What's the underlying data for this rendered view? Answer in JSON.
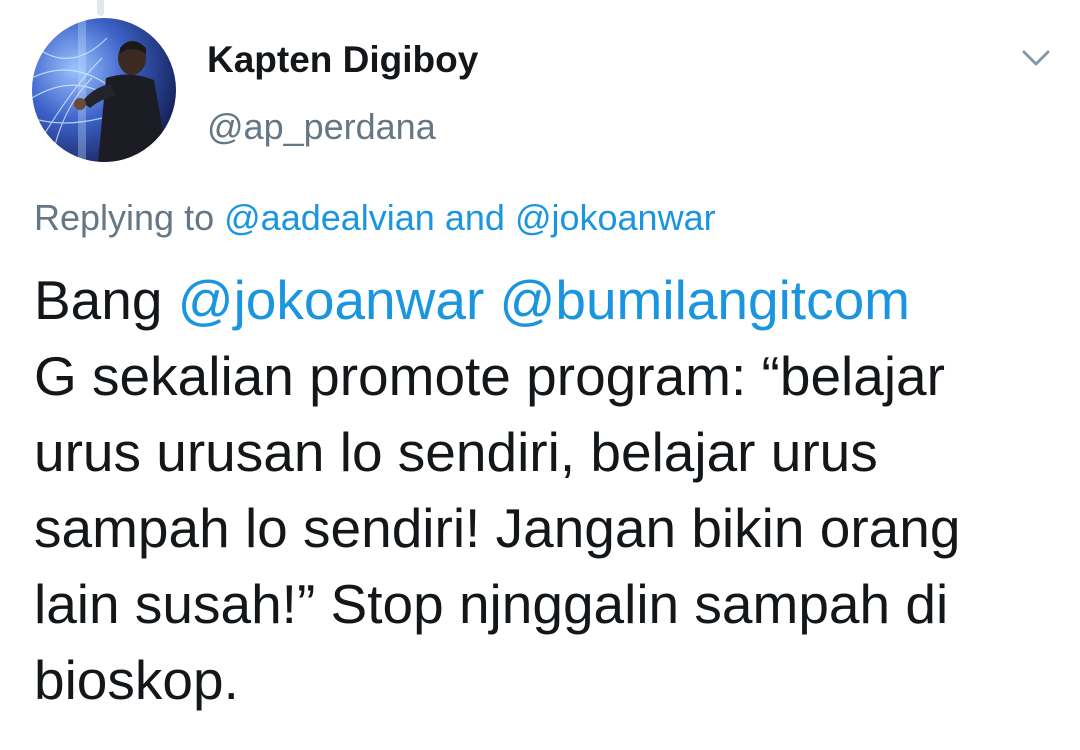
{
  "author": {
    "display_name": "Kapten Digiboy",
    "handle": "@ap_perdana",
    "avatar_icon": "user-avatar-photo"
  },
  "reply": {
    "prefix": "Replying to",
    "mention_1": "@aadealvian",
    "joiner": "and",
    "mention_2": "@jokoanwar"
  },
  "tweet": {
    "line1_word": "Bang",
    "line1_mention_1": "@jokoanwar",
    "line1_mention_2": "@bumilangitcom",
    "line2": "G sekalian promote program: “belajar",
    "line3": "urus urusan lo sendiri, belajar urus",
    "line4": "sampah lo sendiri! Jangan bikin orang",
    "line5": "lain susah!” Stop njnggalin sampah di",
    "line6": "bioskop."
  },
  "menu_icon": "chevron-down-icon",
  "colors": {
    "text": "#14171a",
    "secondary": "#657786",
    "link": "#1b95e0",
    "chevron": "#8899a6",
    "thread_line": "#e1e8ed"
  }
}
